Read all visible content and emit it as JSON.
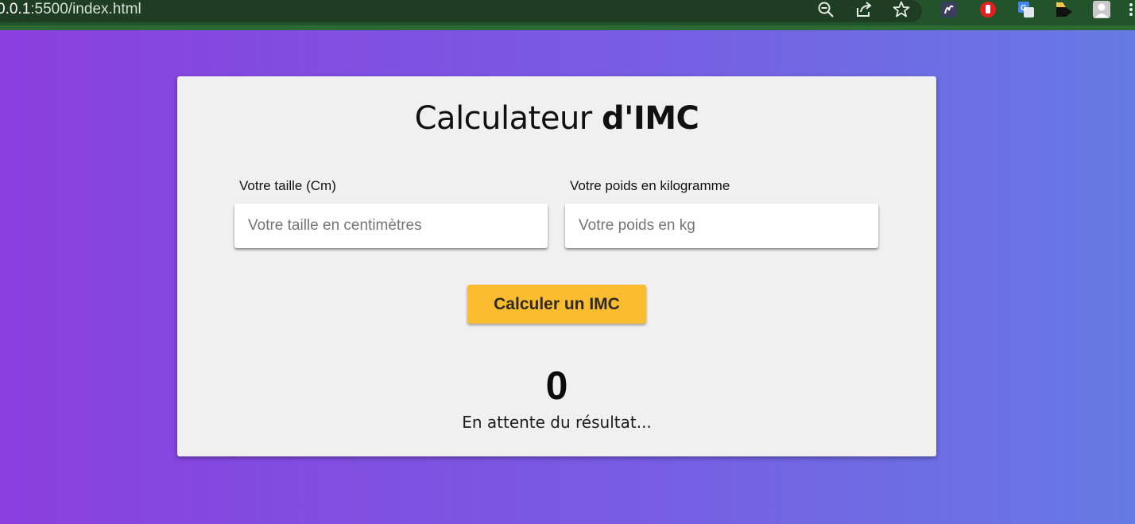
{
  "browser": {
    "url_host": "0.0.1",
    "url_rest": ":5500/index.html",
    "icons": [
      "zoom-out-icon",
      "share-icon",
      "bookmark-star-icon"
    ],
    "extensions": [
      "wave-extension-icon",
      "stop-hand-extension-icon",
      "google-translate-extension-icon",
      "tag-extension-icon",
      "profile-avatar-icon",
      "menu-icon"
    ]
  },
  "colors": {
    "background_start": "#8a3fde",
    "background_end": "#667ae3",
    "card": "#f0f0f0",
    "button": "#fbbd2f"
  },
  "app": {
    "title_light": "Calculateur ",
    "title_bold": "d'IMC",
    "height_label": "Votre taille (Cm)",
    "height_placeholder": "Votre taille en centimètres",
    "weight_label": "Votre poids en kilogramme",
    "weight_placeholder": "Votre poids en kg",
    "button_label": "Calculer un IMC",
    "result_value": "0",
    "status_text": "En attente du résultat..."
  }
}
